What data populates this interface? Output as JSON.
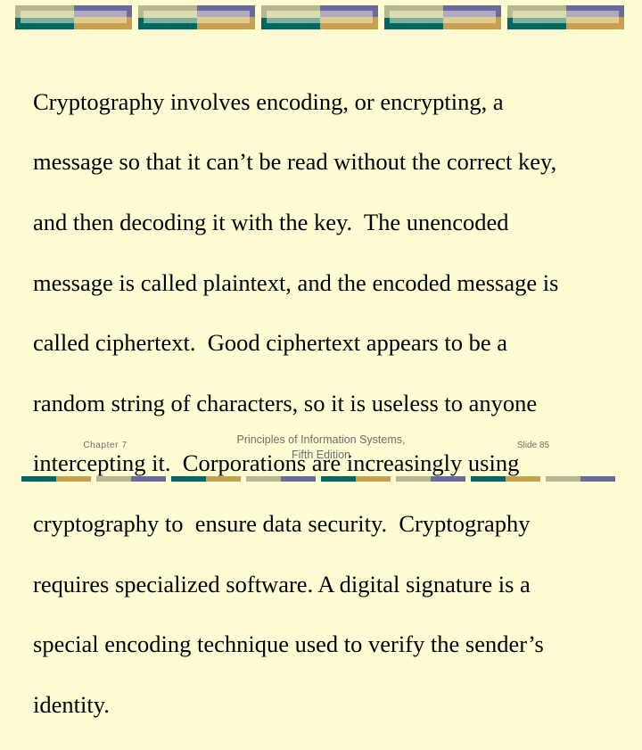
{
  "slide": {
    "body_lines": [
      "Cryptography involves encoding, or encrypting, a",
      "message so that it can’t be read without the correct key,",
      "and then decoding it with the key.  The unencoded",
      "message is called plaintext, and the encoded message is",
      "called ciphertext.  Good ciphertext appears to be a",
      "random string of characters, so it is useless to anyone",
      "intercepting it.  Corporations are increasingly using",
      "cryptography to  ensure data security.  Cryptography",
      "requires specialized software. A digital signature is a",
      "special encoding technique used to verify the sender’s",
      "identity."
    ]
  },
  "footer": {
    "chapter": "Chapter 7",
    "book_title_line1": "Principles of Information Systems,",
    "book_title_line2": "Fifth Edition",
    "slide_number": "Slide 85"
  },
  "theme": {
    "background": "#fdfcd3",
    "khaki": "#b8b890",
    "pale_khaki": "#dcdcb0",
    "light_teal": "#7fb09c",
    "dark_teal": "#006860",
    "purple": "#6a6aa0",
    "lilac": "#b0aac0",
    "pale_gold": "#e0cc90",
    "gold": "#c8a050"
  },
  "decor": {
    "top_block_count": 5,
    "bottom_pattern": [
      "teal-gold",
      "khaki-purple",
      "teal-gold",
      "khaki-purple",
      "teal-gold",
      "khaki-purple",
      "teal-gold",
      "khaki-purple"
    ]
  }
}
